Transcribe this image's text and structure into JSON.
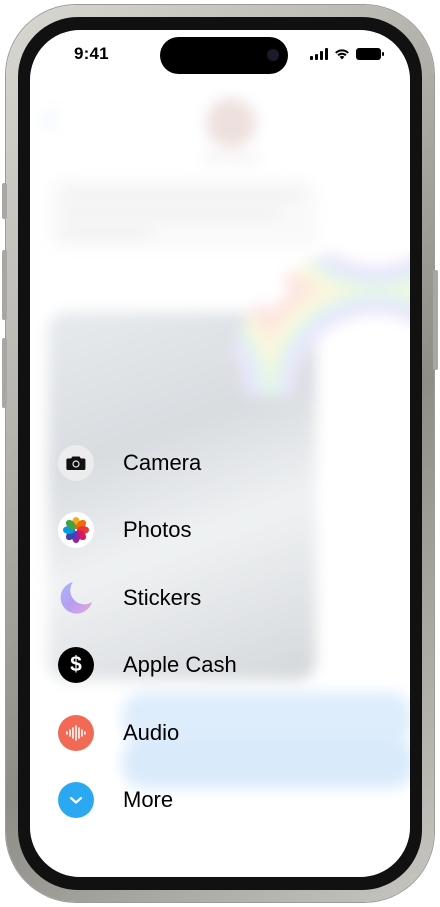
{
  "status_bar": {
    "time": "9:41"
  },
  "menu": {
    "items": [
      {
        "id": "camera",
        "label": "Camera",
        "icon": "camera-icon"
      },
      {
        "id": "photos",
        "label": "Photos",
        "icon": "photos-icon"
      },
      {
        "id": "stickers",
        "label": "Stickers",
        "icon": "stickers-icon"
      },
      {
        "id": "apple-cash",
        "label": "Apple Cash",
        "icon": "apple-cash-icon",
        "glyph": "$"
      },
      {
        "id": "audio",
        "label": "Audio",
        "icon": "audio-waveform-icon"
      },
      {
        "id": "more",
        "label": "More",
        "icon": "chevron-down-icon"
      }
    ]
  },
  "colors": {
    "audio_icon": "#f26a55",
    "more_icon": "#2aa9f2",
    "cash_icon": "#000000",
    "camera_icon_bg": "#ececee"
  }
}
